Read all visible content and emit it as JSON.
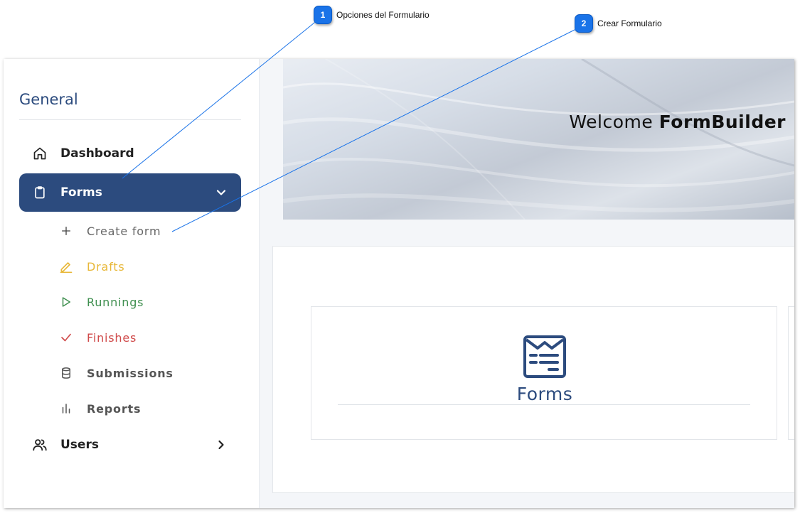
{
  "callouts": [
    {
      "number": "1",
      "label": "Opciones del Formulario"
    },
    {
      "number": "2",
      "label": "Crear Formulario"
    }
  ],
  "sidebar": {
    "heading": "General",
    "items": [
      {
        "label": "Dashboard",
        "icon": "home-icon"
      },
      {
        "label": "Forms",
        "icon": "clipboard-icon",
        "active": true,
        "expanded": true
      },
      {
        "label": "Users",
        "icon": "users-icon"
      }
    ],
    "forms_submenu": [
      {
        "label": "Create form",
        "icon": "plus-icon",
        "color": "#666666"
      },
      {
        "label": "Drafts",
        "icon": "pencil-icon",
        "color": "#e8b83a"
      },
      {
        "label": "Runnings",
        "icon": "play-icon",
        "color": "#3f8f4f"
      },
      {
        "label": "Finishes",
        "icon": "check-icon",
        "color": "#d04a4a"
      },
      {
        "label": "Submissions",
        "icon": "database-icon",
        "color": "#555555"
      },
      {
        "label": "Reports",
        "icon": "bar-chart-icon",
        "color": "#555555"
      }
    ]
  },
  "banner": {
    "welcome": "Welcome",
    "brand": "FormBuilder"
  },
  "cards": [
    {
      "title": "Forms",
      "icon": "form-document-icon"
    }
  ],
  "colors": {
    "primary": "#2c4b7e",
    "callout": "#1a73e8"
  }
}
